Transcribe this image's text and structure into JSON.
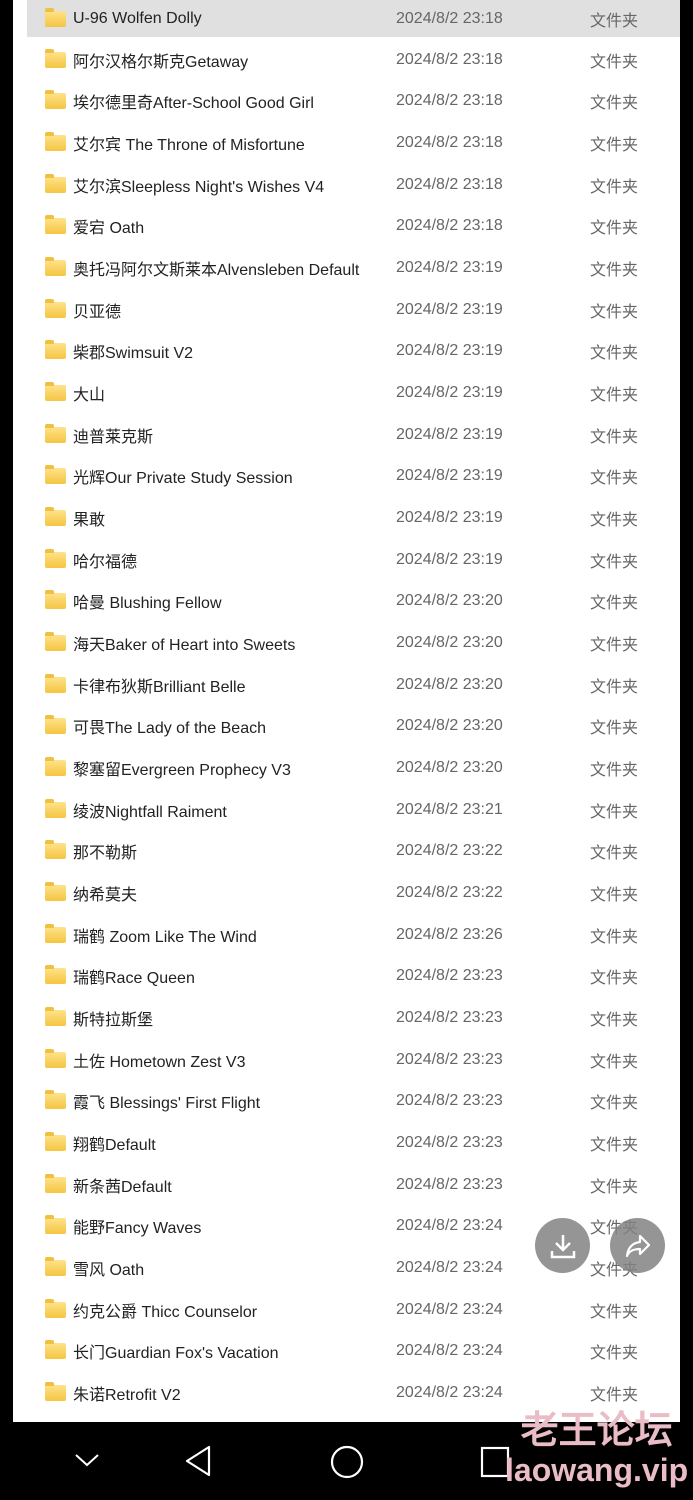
{
  "files": [
    {
      "name": "U-96 Wolfen Dolly",
      "date": "2024/8/2 23:18",
      "type": "文件夹"
    },
    {
      "name": "阿尔汉格尔斯克Getaway",
      "date": "2024/8/2 23:18",
      "type": "文件夹"
    },
    {
      "name": "埃尔德里奇After-School Good Girl",
      "date": "2024/8/2 23:18",
      "type": "文件夹"
    },
    {
      "name": "艾尔宾 The Throne of Misfortune",
      "date": "2024/8/2 23:18",
      "type": "文件夹"
    },
    {
      "name": "艾尔滨Sleepless Night's Wishes V4",
      "date": "2024/8/2 23:18",
      "type": "文件夹"
    },
    {
      "name": "爱宕 Oath",
      "date": "2024/8/2 23:18",
      "type": "文件夹"
    },
    {
      "name": "奥托冯阿尔文斯莱本Alvensleben Default",
      "date": "2024/8/2 23:19",
      "type": "文件夹"
    },
    {
      "name": "贝亚德",
      "date": "2024/8/2 23:19",
      "type": "文件夹"
    },
    {
      "name": "柴郡Swimsuit V2",
      "date": "2024/8/2 23:19",
      "type": "文件夹"
    },
    {
      "name": "大山",
      "date": "2024/8/2 23:19",
      "type": "文件夹"
    },
    {
      "name": "迪普莱克斯",
      "date": "2024/8/2 23:19",
      "type": "文件夹"
    },
    {
      "name": "光辉Our Private Study Session",
      "date": "2024/8/2 23:19",
      "type": "文件夹"
    },
    {
      "name": "果敢",
      "date": "2024/8/2 23:19",
      "type": "文件夹"
    },
    {
      "name": "哈尔福德",
      "date": "2024/8/2 23:19",
      "type": "文件夹"
    },
    {
      "name": "哈曼 Blushing Fellow",
      "date": "2024/8/2 23:20",
      "type": "文件夹"
    },
    {
      "name": "海天Baker of Heart into Sweets",
      "date": "2024/8/2 23:20",
      "type": "文件夹"
    },
    {
      "name": "卡律布狄斯Brilliant Belle",
      "date": "2024/8/2 23:20",
      "type": "文件夹"
    },
    {
      "name": "可畏The Lady of the Beach",
      "date": "2024/8/2 23:20",
      "type": "文件夹"
    },
    {
      "name": "黎塞留Evergreen Prophecy V3",
      "date": "2024/8/2 23:20",
      "type": "文件夹"
    },
    {
      "name": "绫波Nightfall Raiment",
      "date": "2024/8/2 23:21",
      "type": "文件夹"
    },
    {
      "name": "那不勒斯",
      "date": "2024/8/2 23:22",
      "type": "文件夹"
    },
    {
      "name": "纳希莫夫",
      "date": "2024/8/2 23:22",
      "type": "文件夹"
    },
    {
      "name": "瑞鹤 Zoom Like The Wind",
      "date": "2024/8/2 23:26",
      "type": "文件夹"
    },
    {
      "name": "瑞鹤Race Queen",
      "date": "2024/8/2 23:23",
      "type": "文件夹"
    },
    {
      "name": "斯特拉斯堡",
      "date": "2024/8/2 23:23",
      "type": "文件夹"
    },
    {
      "name": "土佐 Hometown Zest V3",
      "date": "2024/8/2 23:23",
      "type": "文件夹"
    },
    {
      "name": "霞飞 Blessings' First Flight",
      "date": "2024/8/2 23:23",
      "type": "文件夹"
    },
    {
      "name": "翔鹤Default",
      "date": "2024/8/2 23:23",
      "type": "文件夹"
    },
    {
      "name": "新条茜Default",
      "date": "2024/8/2 23:23",
      "type": "文件夹"
    },
    {
      "name": "能野Fancy Waves",
      "date": "2024/8/2 23:24",
      "type": "文件夹"
    },
    {
      "name": "雪风 Oath",
      "date": "2024/8/2 23:24",
      "type": "文件夹"
    },
    {
      "name": "约克公爵 Thicc Counselor",
      "date": "2024/8/2 23:24",
      "type": "文件夹"
    },
    {
      "name": "长门Guardian Fox's Vacation",
      "date": "2024/8/2 23:24",
      "type": "文件夹"
    },
    {
      "name": "朱诺Retrofit V2",
      "date": "2024/8/2 23:24",
      "type": "文件夹"
    }
  ],
  "selected_index": 0,
  "watermark": {
    "line1": "老王论坛",
    "line2": "laowang.vip"
  },
  "icons": {
    "download": "download-icon",
    "share": "share-icon",
    "nav": [
      "chevron-down-icon",
      "back-triangle-icon",
      "home-circle-icon",
      "recents-square-icon"
    ]
  }
}
